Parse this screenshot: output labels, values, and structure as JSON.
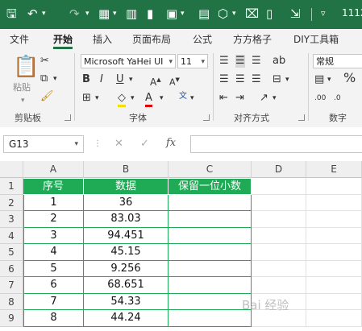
{
  "title_bar": {
    "title": "1112"
  },
  "tabs": [
    "文件",
    "开始",
    "插入",
    "页面布局",
    "公式",
    "方方格子",
    "DIY工具箱"
  ],
  "ribbon": {
    "clipboard": {
      "paste": "粘贴",
      "label": "剪贴板"
    },
    "font": {
      "name": "Microsoft YaHei UI",
      "size": "11",
      "label": "字体"
    },
    "alignment": {
      "label": "对齐方式"
    },
    "number": {
      "format": "常规",
      "label": "数字"
    }
  },
  "formula_bar": {
    "name_box": "G13",
    "fx": "fx"
  },
  "sheet": {
    "columns": [
      "A",
      "B",
      "C",
      "D",
      "E"
    ],
    "rows": [
      "1",
      "2",
      "3",
      "4",
      "5",
      "6",
      "7",
      "8",
      "9"
    ],
    "header": [
      "序号",
      "数据",
      "保留一位小数"
    ],
    "data": [
      [
        "1",
        "36"
      ],
      [
        "2",
        "83.03"
      ],
      [
        "3",
        "94.451"
      ],
      [
        "4",
        "45.15"
      ],
      [
        "5",
        "9.256"
      ],
      [
        "6",
        "68.651"
      ],
      [
        "7",
        "54.33"
      ],
      [
        "8",
        "44.24"
      ]
    ]
  },
  "watermark": "Bai 经验",
  "colors": {
    "accent": "#217346",
    "table_header": "#1faa55"
  }
}
